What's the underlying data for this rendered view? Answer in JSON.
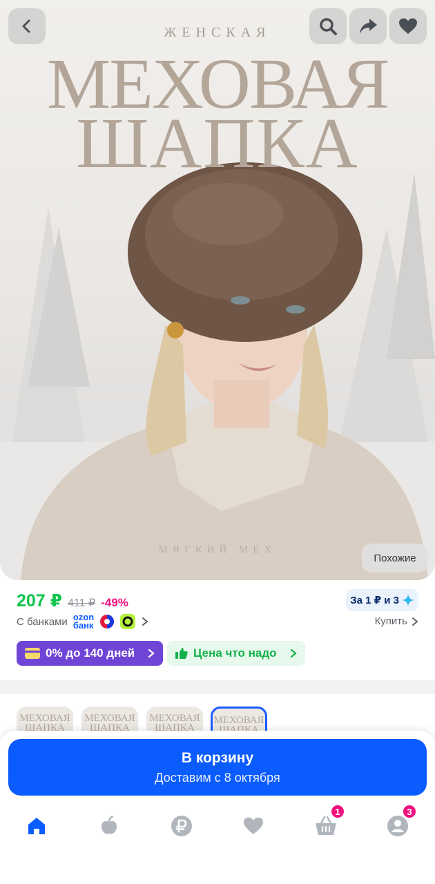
{
  "header": {
    "back_icon": "chevron-left-icon",
    "search_icon": "search-icon",
    "share_icon": "share-icon",
    "favorite_icon": "heart-icon"
  },
  "product_image": {
    "subtitle": "ЖЕНСКАЯ",
    "title_line1": "МЕХОВАЯ",
    "title_line2": "ШАПКА",
    "caption": "МЯГКИЙ МЕХ",
    "similar_label": "Похожие"
  },
  "price": {
    "current": "207 ₽",
    "old": "411 ₽",
    "discount": "-49%",
    "installment_badge": "За 1 ₽ и 3",
    "banks_label": "С банками",
    "ozon_bank_line1": "ozon",
    "ozon_bank_line2": "банк",
    "buy_label": "Купить",
    "promo_installment": "0% до 140 дней",
    "promo_price": "Цена что надо"
  },
  "thumbnails": [
    {
      "line1": "МЕХОВАЯ",
      "line2": "ШАПКА",
      "selected": false
    },
    {
      "line1": "МЕХОВАЯ",
      "line2": "ШАПКА",
      "selected": false
    },
    {
      "line1": "МЕХОВАЯ",
      "line2": "ШАПКА",
      "selected": false
    },
    {
      "line1": "МЕХОВАЯ",
      "line2": "ШАПКА",
      "selected": true
    }
  ],
  "cart": {
    "label": "В корзину",
    "delivery": "Доставим с 8 октября"
  },
  "nav": {
    "items": [
      {
        "icon": "home-icon"
      },
      {
        "icon": "fresh-icon"
      },
      {
        "icon": "ruble-icon"
      },
      {
        "icon": "heart-icon"
      },
      {
        "icon": "cart-icon",
        "badge": "1"
      },
      {
        "icon": "profile-icon",
        "badge": "3"
      }
    ]
  },
  "colors": {
    "accent": "#0b5cff",
    "price": "#10c44c",
    "discount": "#f1117e",
    "promo_purple": "#6f45d6"
  }
}
